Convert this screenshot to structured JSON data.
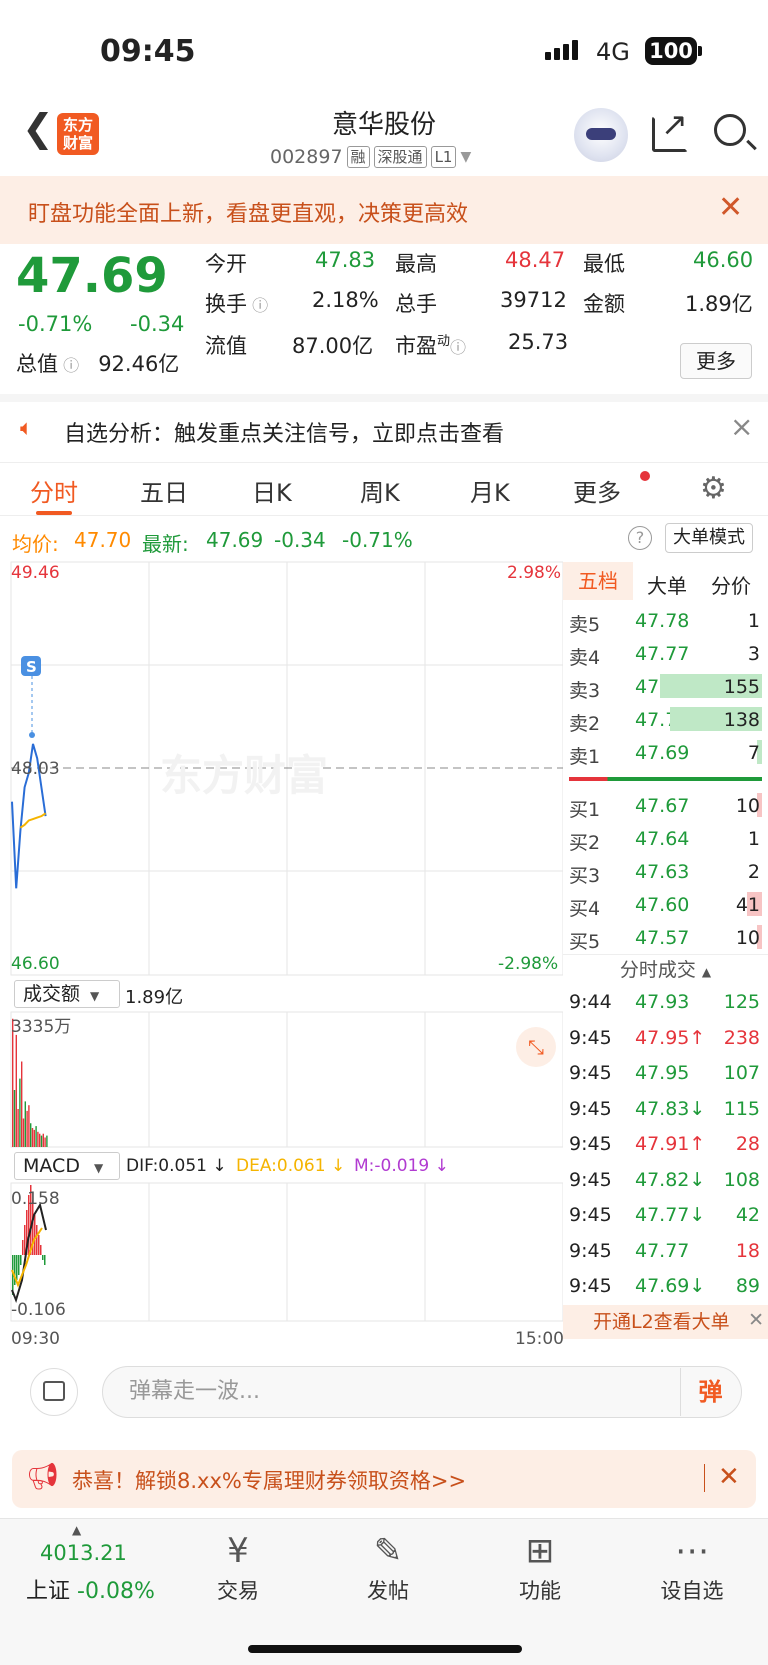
{
  "status": {
    "time": "09:45",
    "network": "4G",
    "battery": "100"
  },
  "header": {
    "title": "意华股份",
    "code": "002897",
    "tags": [
      "融",
      "深股通",
      "L1"
    ],
    "logo_line1": "东方",
    "logo_line2": "财富"
  },
  "banner": {
    "text": "盯盘功能全面上新，看盘更直观，决策更高效"
  },
  "quote": {
    "price": "47.69",
    "change_pct": "-0.71%",
    "change": "-0.34",
    "total_value_label": "总值",
    "total_value": "92.46亿",
    "fields": [
      {
        "label": "今开",
        "value": "47.83"
      },
      {
        "label": "最高",
        "value": "48.47"
      },
      {
        "label": "最低",
        "value": "46.60"
      },
      {
        "label": "换手",
        "value": "2.18%"
      },
      {
        "label": "总手",
        "value": "39712"
      },
      {
        "label": "金额",
        "value": "1.89亿"
      },
      {
        "label": "流值",
        "value": "87.00亿"
      },
      {
        "label": "市盈",
        "value": "25.73",
        "sup": "动"
      }
    ],
    "more": "更多"
  },
  "notice": {
    "text": "自选分析：触发重点关注信号，立即点击查看"
  },
  "tabs": [
    "分时",
    "五日",
    "日K",
    "周K",
    "月K",
    "更多"
  ],
  "info": {
    "avg_label": "均价:",
    "avg": "47.70",
    "latest_label": "最新:",
    "latest": "47.69",
    "chg": "-0.34",
    "pct": "-0.71%",
    "mode": "大单模式"
  },
  "chart": {
    "y_high": "49.46",
    "y_low": "46.60",
    "pct_high": "2.98%",
    "pct_low": "-2.98%",
    "prev_close": "48.03",
    "watermark": "东方财富",
    "vol_label": "成交额",
    "vol_total": "1.89亿",
    "vol_max": "3335万",
    "macd_label": "MACD",
    "dif": "DIF:0.051",
    "dea": "DEA:0.061",
    "m": "M:-0.019",
    "macd_high": "0.158",
    "macd_low": "-0.106",
    "t_start": "09:30",
    "t_end": "15:00",
    "signal": "S"
  },
  "chart_data": {
    "type": "line",
    "series": [
      {
        "values": [
          47.8,
          47.2,
          47.6,
          47.9,
          48.0,
          48.2,
          48.1,
          47.9,
          47.7
        ]
      }
    ],
    "ylim": [
      46.6,
      49.46
    ],
    "prev_close": 48.03
  },
  "orderbook": {
    "tabs": [
      "五档",
      "大单",
      "分价"
    ],
    "asks": [
      {
        "l": "卖5",
        "p": "47.78",
        "v": "1",
        "w": 0
      },
      {
        "l": "卖4",
        "p": "47.77",
        "v": "3",
        "w": 0
      },
      {
        "l": "卖3",
        "p": "47.76",
        "v": "155",
        "w": 1.0
      },
      {
        "l": "卖2",
        "p": "47.70",
        "v": "138",
        "w": 0.9
      },
      {
        "l": "卖1",
        "p": "47.69",
        "v": "7",
        "w": 0.05
      }
    ],
    "bids": [
      {
        "l": "买1",
        "p": "47.67",
        "v": "10",
        "w": 0.05
      },
      {
        "l": "买2",
        "p": "47.64",
        "v": "1",
        "w": 0
      },
      {
        "l": "买3",
        "p": "47.63",
        "v": "2",
        "w": 0
      },
      {
        "l": "买4",
        "p": "47.60",
        "v": "41",
        "w": 0.15
      },
      {
        "l": "买5",
        "p": "47.57",
        "v": "10",
        "w": 0.05
      }
    ],
    "ticks_label": "分时成交",
    "ticks": [
      {
        "t": "9:44",
        "p": "47.93",
        "v": "125",
        "c": "green"
      },
      {
        "t": "9:45",
        "p": "47.95↑",
        "v": "238",
        "c": "red"
      },
      {
        "t": "9:45",
        "p": "47.95",
        "v": "107",
        "c": "green"
      },
      {
        "t": "9:45",
        "p": "47.83↓",
        "v": "115",
        "c": "green"
      },
      {
        "t": "9:45",
        "p": "47.91↑",
        "v": "28",
        "c": "red"
      },
      {
        "t": "9:45",
        "p": "47.82↓",
        "v": "108",
        "c": "green"
      },
      {
        "t": "9:45",
        "p": "47.77↓",
        "v": "42",
        "c": "green"
      },
      {
        "t": "9:45",
        "p": "47.77",
        "v": "18",
        "c": "red"
      },
      {
        "t": "9:45",
        "p": "47.69↓",
        "v": "89",
        "c": "green"
      }
    ],
    "l2": "开通L2查看大单"
  },
  "danmu": {
    "placeholder": "弹幕走一波...",
    "btn": "弹"
  },
  "promo": {
    "text": "恭喜！解锁8.xx%专属理财券领取资格>>"
  },
  "bottom": {
    "index_value": "4013.21",
    "index_name": "上证",
    "index_pct": "-0.08%",
    "items": [
      "交易",
      "发帖",
      "功能",
      "设自选"
    ]
  }
}
